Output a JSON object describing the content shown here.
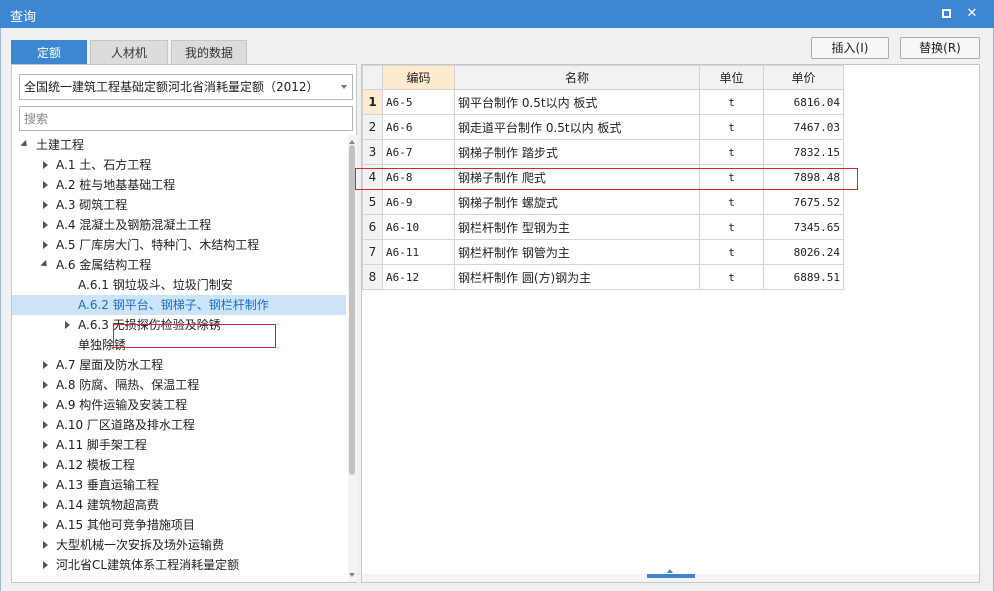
{
  "window": {
    "title": "查询"
  },
  "tabs": [
    {
      "label": "定额",
      "active": true
    },
    {
      "label": "人材机",
      "active": false
    },
    {
      "label": "我的数据",
      "active": false
    }
  ],
  "buttons": {
    "insert": "插入(I)",
    "replace": "替换(R)"
  },
  "library": {
    "selected": "全国统一建筑工程基础定额河北省消耗量定额（2012）"
  },
  "search": {
    "placeholder": "搜索"
  },
  "tree": [
    {
      "label": "土建工程",
      "level": 0,
      "toggle": "expanded"
    },
    {
      "label": "A.1 土、石方工程",
      "level": 1,
      "toggle": "collapsed"
    },
    {
      "label": "A.2 桩与地基基础工程",
      "level": 1,
      "toggle": "collapsed"
    },
    {
      "label": "A.3 砌筑工程",
      "level": 1,
      "toggle": "collapsed"
    },
    {
      "label": "A.4 混凝土及钢筋混凝土工程",
      "level": 1,
      "toggle": "collapsed"
    },
    {
      "label": "A.5 厂库房大门、特种门、木结构工程",
      "level": 1,
      "toggle": "collapsed"
    },
    {
      "label": "A.6 金属结构工程",
      "level": 1,
      "toggle": "expanded"
    },
    {
      "label": "A.6.1 钢垃圾斗、垃圾门制安",
      "level": 2,
      "toggle": "none"
    },
    {
      "label": "A.6.2 钢平台、钢梯子、钢栏杆制作",
      "level": 2,
      "toggle": "none",
      "selected": true
    },
    {
      "label": "A.6.3 无损探伤检验及除锈",
      "level": 2,
      "toggle": "collapsed"
    },
    {
      "label": "单独除锈",
      "level": 2,
      "toggle": "none"
    },
    {
      "label": "A.7 屋面及防水工程",
      "level": 1,
      "toggle": "collapsed"
    },
    {
      "label": "A.8 防腐、隔热、保温工程",
      "level": 1,
      "toggle": "collapsed"
    },
    {
      "label": "A.9 构件运输及安装工程",
      "level": 1,
      "toggle": "collapsed"
    },
    {
      "label": "A.10 厂区道路及排水工程",
      "level": 1,
      "toggle": "collapsed"
    },
    {
      "label": "A.11 脚手架工程",
      "level": 1,
      "toggle": "collapsed"
    },
    {
      "label": "A.12 模板工程",
      "level": 1,
      "toggle": "collapsed"
    },
    {
      "label": "A.13 垂直运输工程",
      "level": 1,
      "toggle": "collapsed"
    },
    {
      "label": "A.14 建筑物超高费",
      "level": 1,
      "toggle": "collapsed"
    },
    {
      "label": "A.15 其他可竞争措施项目",
      "level": 1,
      "toggle": "collapsed"
    },
    {
      "label": "大型机械一次安拆及场外运输费",
      "level": 1,
      "toggle": "collapsed"
    },
    {
      "label": "河北省CL建筑体系工程消耗量定额",
      "level": 1,
      "toggle": "collapsed"
    }
  ],
  "table": {
    "columns": [
      "编码",
      "名称",
      "单位",
      "单价"
    ],
    "rows": [
      {
        "idx": "1",
        "code": "A6-5",
        "name": "钢平台制作 0.5t以内 板式",
        "unit": "t",
        "price": "6816.04"
      },
      {
        "idx": "2",
        "code": "A6-6",
        "name": "钢走道平台制作 0.5t以内 板式",
        "unit": "t",
        "price": "7467.03"
      },
      {
        "idx": "3",
        "code": "A6-7",
        "name": "钢梯子制作 踏步式",
        "unit": "t",
        "price": "7832.15"
      },
      {
        "idx": "4",
        "code": "A6-8",
        "name": "钢梯子制作 爬式",
        "unit": "t",
        "price": "7898.48"
      },
      {
        "idx": "5",
        "code": "A6-9",
        "name": "钢梯子制作 螺旋式",
        "unit": "t",
        "price": "7675.52"
      },
      {
        "idx": "6",
        "code": "A6-10",
        "name": "钢栏杆制作 型钢为主",
        "unit": "t",
        "price": "7345.65"
      },
      {
        "idx": "7",
        "code": "A6-11",
        "name": "钢栏杆制作 钢管为主",
        "unit": "t",
        "price": "8026.24"
      },
      {
        "idx": "8",
        "code": "A6-12",
        "name": "钢栏杆制作 圆(方)钢为主",
        "unit": "t",
        "price": "6889.51"
      }
    ]
  },
  "colors": {
    "accent": "#3c86d2",
    "highlight_border": "#d8262e",
    "selected_row": "#cce4f7"
  }
}
